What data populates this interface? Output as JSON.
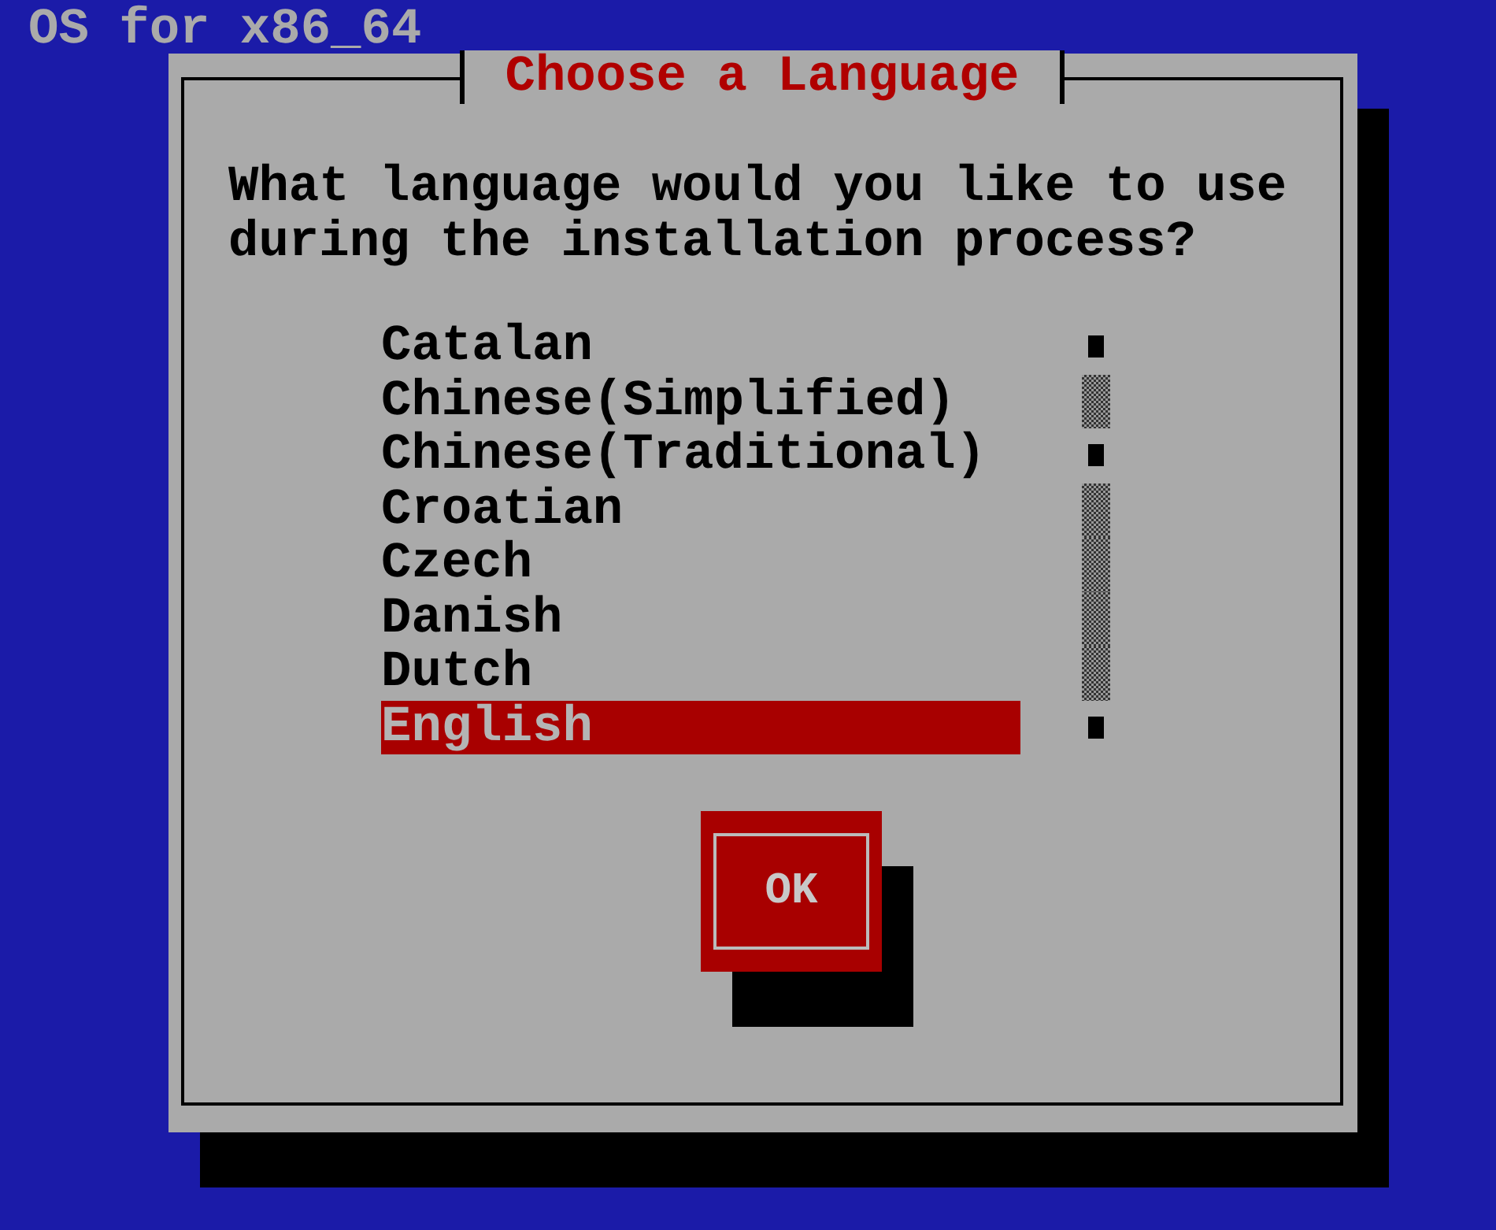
{
  "header": {
    "title": "OS for x86_64"
  },
  "dialog": {
    "title": "Choose a Language",
    "prompt": "What language would you like to use during the installation process?",
    "languages": [
      {
        "label": "Catalan",
        "selected": false
      },
      {
        "label": "Chinese(Simplified)",
        "selected": false
      },
      {
        "label": "Chinese(Traditional)",
        "selected": false
      },
      {
        "label": "Croatian",
        "selected": false
      },
      {
        "label": "Czech",
        "selected": false
      },
      {
        "label": "Danish",
        "selected": false
      },
      {
        "label": "Dutch",
        "selected": false
      },
      {
        "label": "English",
        "selected": true
      }
    ],
    "buttons": [
      {
        "label": "OK"
      }
    ]
  }
}
